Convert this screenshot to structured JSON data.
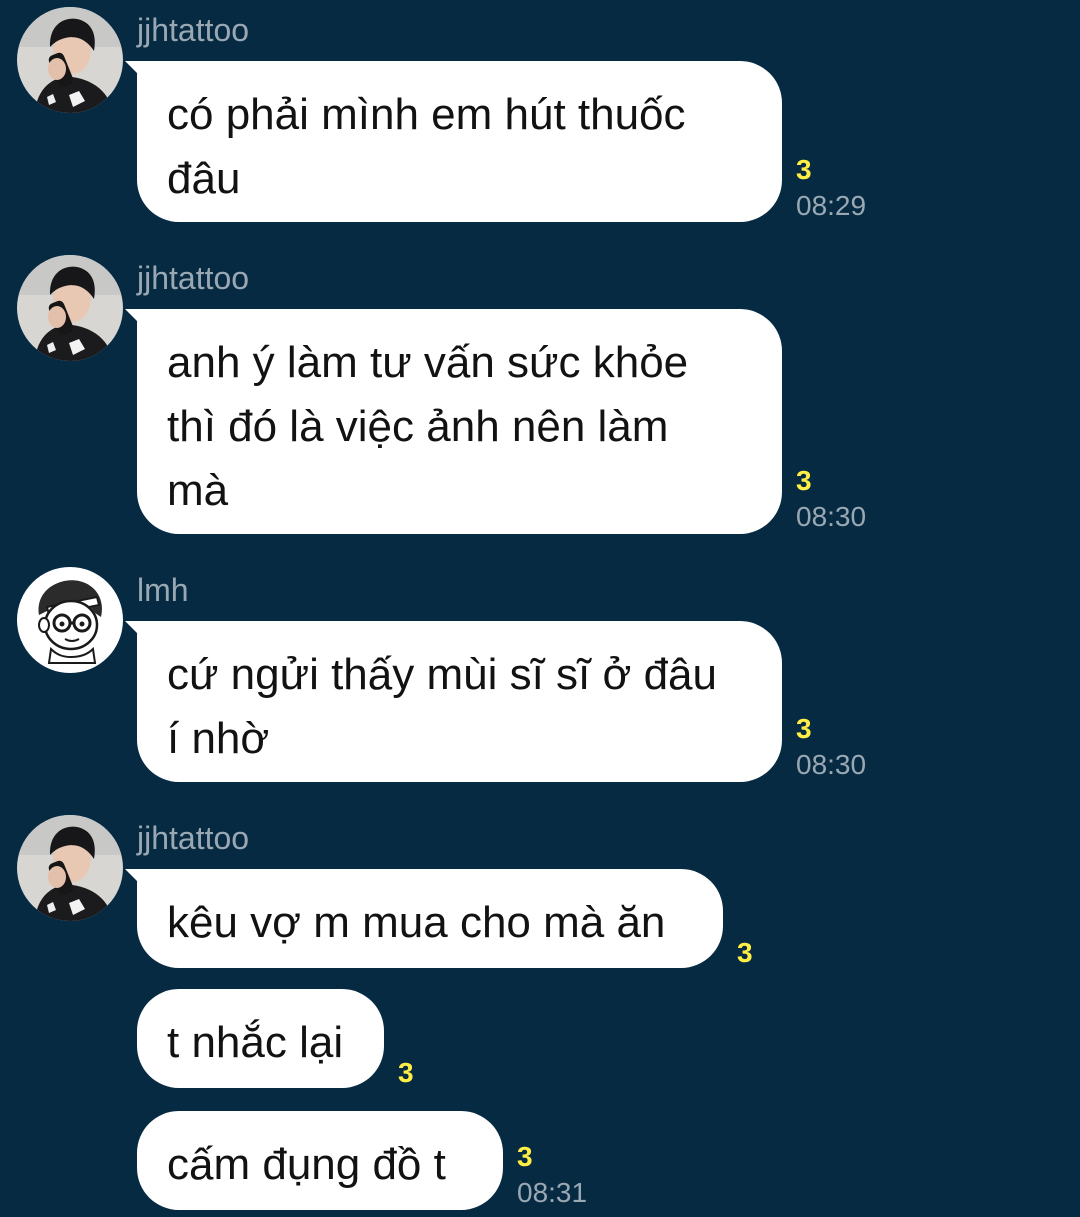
{
  "colors": {
    "background": "#062a42",
    "bubble": "#ffffff",
    "read_count": "#ffef45",
    "meta_text": "#9aa8b4"
  },
  "messages": [
    {
      "sender": "jjhtattoo",
      "text": "có phải mình em hút thuốc\nđâu",
      "read": "3",
      "time": "08:29"
    },
    {
      "sender": "jjhtattoo",
      "text": "anh ý làm tư vấn sức khỏe\nthì đó là việc ảnh nên làm\nmà",
      "read": "3",
      "time": "08:30"
    },
    {
      "sender": "lmh",
      "text": "cứ ngửi thấy mùi sĩ sĩ ở đâu\ní nhờ",
      "read": "3",
      "time": "08:30"
    },
    {
      "sender": "jjhtattoo",
      "text": "kêu vợ m mua cho mà ăn",
      "read": "3",
      "time": ""
    },
    {
      "sender": "",
      "text": "t nhắc lại",
      "read": "3",
      "time": ""
    },
    {
      "sender": "",
      "text": "cấm đụng đồ t",
      "read": "3",
      "time": "08:31"
    }
  ]
}
